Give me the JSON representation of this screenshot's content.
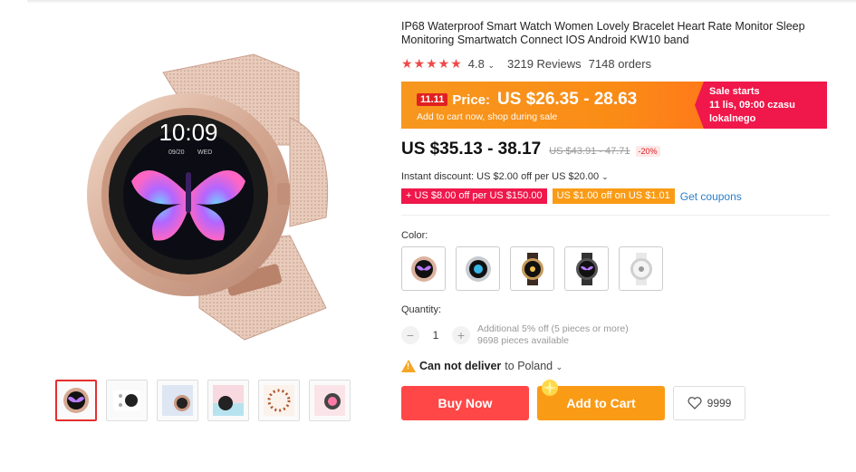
{
  "product": {
    "title": "IP68 Waterproof Smart Watch Women Lovely Bracelet Heart Rate Monitor Sleep Monitoring Smartwatch Connect IOS Android KW10 band",
    "stars": "★★★★★",
    "rating": "4.8",
    "reviews": "3219 Reviews",
    "orders": "7148 orders"
  },
  "promo": {
    "badge": "11.11",
    "price_label": "Price:",
    "price": "US $26.35 - 28.63",
    "sub": "Add to cart now, shop during sale",
    "sale_line1": "Sale starts",
    "sale_line2": "11 lis, 09:00 czasu",
    "sale_line3": "lokalnego"
  },
  "pricing": {
    "current": "US $35.13 - 38.17",
    "original": "US $43.91 - 47.71",
    "discount": "-20%",
    "instant": "Instant discount: US $2.00 off per US $20.00",
    "coupon1": "US $8.00 off per US $150.00",
    "coupon2": "US $1.00 off on US $1.01",
    "get_coupons": "Get coupons"
  },
  "options": {
    "color_label": "Color:",
    "quantity_label": "Quantity:",
    "quantity": "1",
    "qty_note1": "Additional 5% off (5 pieces or more)",
    "qty_note2": "9698 pieces available"
  },
  "delivery": {
    "bold": "Can not deliver",
    "to": "to Poland"
  },
  "actions": {
    "buy": "Buy Now",
    "cart": "Add to Cart",
    "wishlist": "9999"
  },
  "colors": {
    "accent_red": "#ff4747",
    "accent_orange": "#fa9b16",
    "promo_pink": "#f0174a",
    "link_blue": "#2a7fc8"
  }
}
